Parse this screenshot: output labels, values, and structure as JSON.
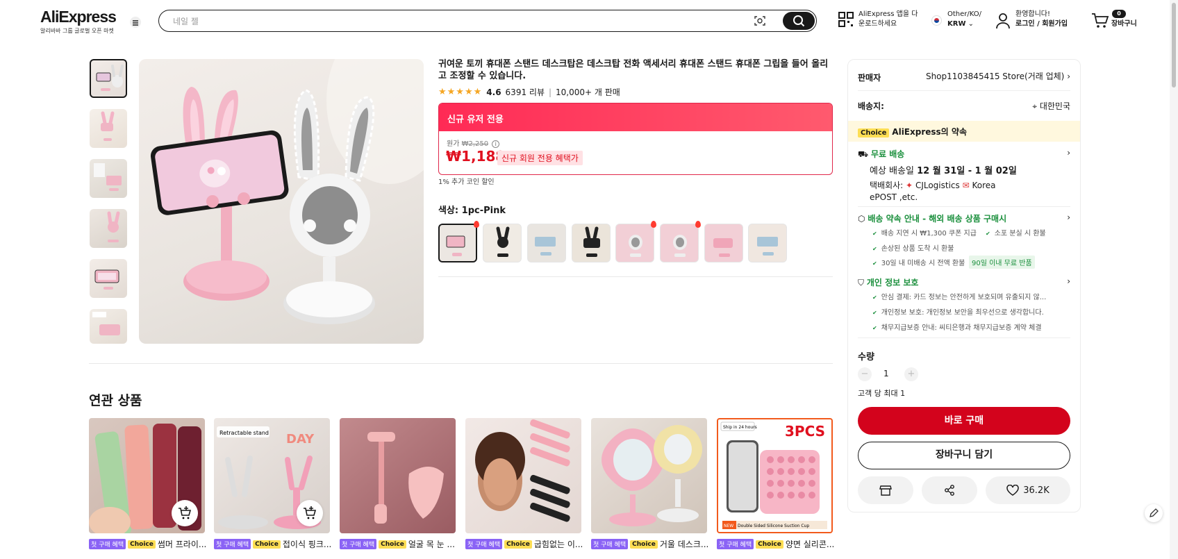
{
  "header": {
    "logo_text": "AliExpress",
    "logo_sub": "알리바바 그룹 글로벌 오픈 마켓",
    "search_placeholder": "네일 젤",
    "app_line1": "AliExpress 앱을 다",
    "app_line2": "운로드하세요",
    "region_line1": "Other/KO/",
    "region_line2": "KRW",
    "account_line1": "환영합니다!",
    "account_line2": "로그인 / 회원가입",
    "cart_count": "0",
    "cart_label": "장바구니"
  },
  "product": {
    "title": "귀여운 토끼 휴대폰 스탠드 데스크탑은 데스크탑 전화 액세서리 휴대폰 스탠드 휴대폰 그립을 들어 올리고 조정할 수 있습니다.",
    "rating": "4.6",
    "reviews": "6391 리뷰",
    "sold": "10,000+ 개 판매",
    "promo_header": "신규 유저 전용",
    "orig_label": "원가",
    "orig_price": "₩2,250",
    "price": "₩1,188",
    "price_badge": "신규 회원 전용 혜택가",
    "coin_note": "1% 추가 코인 할인",
    "color_label": "색상: 1pc-Pink"
  },
  "panel": {
    "seller_label": "판매자",
    "seller_name": "Shop1103845415 Store(거래 업체)",
    "ship_to_label": "배송지:",
    "ship_to": "대한민국",
    "choice_tag": "Choice",
    "choice_promise": "AliExpress의 약속",
    "free_shipping": "무료 배송",
    "eta_prefix": "예상 배송일",
    "eta": "12 월 31일 - 1 월 02일",
    "carrier_label": "택배회사:",
    "carrier1": "CJLogistics",
    "carrier2": "Korea",
    "carrier3": "ePOST ,etc.",
    "promise_title": "배송 약속 안내 - 해외 배송 상품 구매시",
    "promise1": "배송 지연 시 ₩1,300 쿠폰 지급",
    "promise2": "소포 분실 시 환불",
    "promise3": "손상된 상품 도착 시 환불",
    "promise4": "30일 내 미배송 시 전액 환불",
    "promise_tag": "90일 이내 무료 반품",
    "privacy_title": "개인 정보 보호",
    "privacy1": "안심 결제: 카드 정보는 안전하게 보호되며 유출되지 않...",
    "privacy2": "개인정보 보호: 개인정보 보안을 최우선으로 생각합니다.",
    "privacy3": "채무지급보증 안내: 씨티은행과 채무지급보증 계약 체결",
    "qty_label": "수량",
    "qty_value": "1",
    "qty_limit": "고객 당 최대 1",
    "buy_now": "바로 구매",
    "add_to_cart": "장바구니 담기",
    "wishlist_count": "36.2K"
  },
  "related": {
    "heading": "연관 상품",
    "items": [
      {
        "badge": "첫 구매 혜택",
        "choice": "Choice",
        "name": "썸머 프라이..."
      },
      {
        "badge": "첫 구매 혜택",
        "choice": "Choice",
        "name": "접이식 핑크..."
      },
      {
        "badge": "첫 구매 혜택",
        "choice": "Choice",
        "name": "얼굴 목 눈 ..."
      },
      {
        "badge": "첫 구매 혜택",
        "choice": "Choice",
        "name": "굽힘없는 이..."
      },
      {
        "badge": "첫 구매 혜택",
        "choice": "Choice",
        "name": "거울 데스크..."
      },
      {
        "badge": "첫 구매 혜택",
        "choice": "Choice",
        "name": "양면 실리콘..."
      }
    ],
    "card2_text": "Retractable stand",
    "card6_text": "3PCS",
    "card6_ship": "Ship in 24 hours",
    "card6_foot": "Double Sided Silicone Suction Cup",
    "card6_new": "NEW"
  },
  "colors": {
    "accent": "#d3031c",
    "promo": "#ff2a55",
    "choice": "#fdde54",
    "green": "#1a8f3c"
  }
}
